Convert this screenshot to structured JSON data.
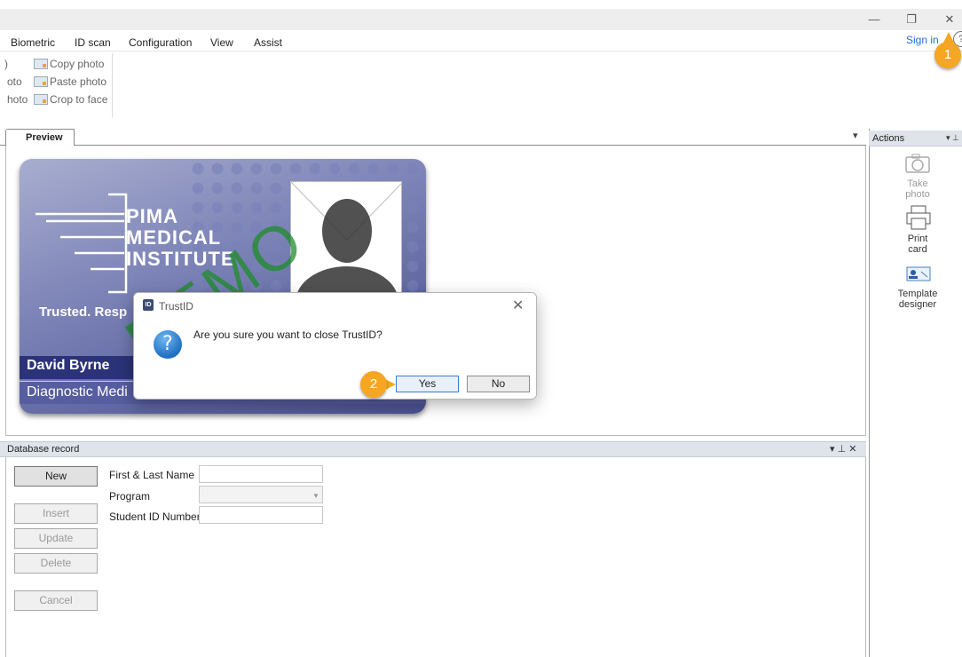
{
  "window": {
    "minimize_glyph": "—",
    "restore_glyph": "❐",
    "close_glyph": "✕"
  },
  "menu": {
    "items": [
      "Biometric",
      "ID scan",
      "Configuration",
      "View",
      "Assist"
    ],
    "sign_in": "Sign in",
    "help_glyph": "?"
  },
  "ribbon": {
    "left_clipped": [
      ")",
      "oto",
      "hoto"
    ],
    "items": [
      {
        "label": "Copy photo",
        "icon": "copy-photo-icon"
      },
      {
        "label": "Paste photo",
        "icon": "paste-photo-icon"
      },
      {
        "label": "Crop to face",
        "icon": "crop-face-icon"
      }
    ]
  },
  "preview": {
    "tab_label": "Preview",
    "dropdown_glyph": "▾"
  },
  "card": {
    "brand_line1": "PIMA",
    "brand_line2": "MEDICAL",
    "brand_line3": "INSTITUTE",
    "tagline": "Trusted. Resp",
    "person_name": "David Byrne",
    "role": "Diagnostic Medi",
    "watermark": "DEMO"
  },
  "actions": {
    "title": "Actions",
    "pin_glyph": "▾ ⊥",
    "items": [
      {
        "label_line1": "Take",
        "label_line2": "photo",
        "icon": "camera-icon"
      },
      {
        "label_line1": "Print",
        "label_line2": "card",
        "icon": "printer-icon"
      },
      {
        "label_line1": "Template",
        "label_line2": "designer",
        "icon": "template-designer-icon"
      }
    ]
  },
  "database_record": {
    "title": "Database record",
    "controls": "▾ ⊥ ✕",
    "buttons": {
      "new": "New",
      "insert": "Insert",
      "update": "Update",
      "delete": "Delete",
      "cancel": "Cancel"
    },
    "fields": {
      "name_label": "First & Last Name",
      "program_label": "Program",
      "student_id_label": "Student ID Number",
      "name_value": "",
      "program_value": "",
      "student_id_value": ""
    }
  },
  "dialog": {
    "title": "TrustID",
    "icon_text": "ID",
    "close_glyph": "✕",
    "question_glyph": "?",
    "message": "Are you sure you want to close TrustID?",
    "yes": "Yes",
    "no": "No"
  },
  "callouts": {
    "one": "1",
    "two": "2"
  },
  "colors": {
    "accent": "#f5a623",
    "link": "#2a6fd6",
    "card_dark": "#2b3277"
  }
}
